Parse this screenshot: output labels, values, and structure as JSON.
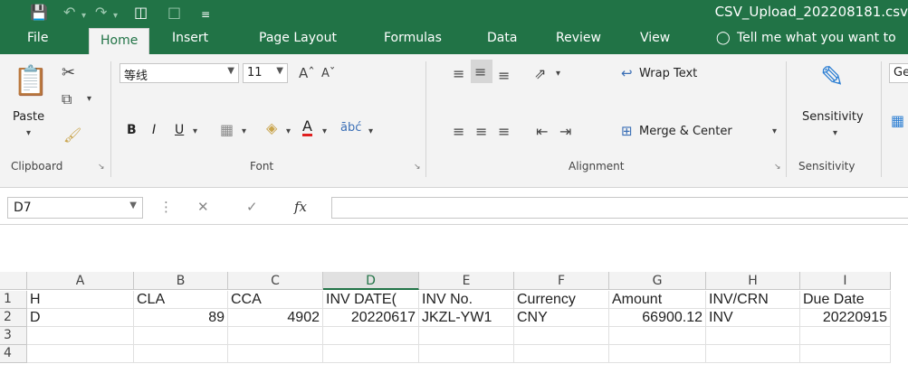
{
  "window": {
    "title": "CSV_Upload_202208181.csv"
  },
  "tabs": [
    "File",
    "Home",
    "Insert",
    "Page Layout",
    "Formulas",
    "Data",
    "Review",
    "View"
  ],
  "active_tab": "Home",
  "tell_me": "Tell me what you want to",
  "clipboard": {
    "paste": "Paste",
    "label": "Clipboard"
  },
  "font": {
    "name": "等线",
    "size": "11",
    "bold": "B",
    "italic": "I",
    "underline": "U",
    "color_letter": "A",
    "label": "Font"
  },
  "alignment": {
    "wrap_text": "Wrap Text",
    "merge_center": "Merge & Center",
    "label": "Alignment"
  },
  "sensitivity": {
    "button": "Sensitivity",
    "label": "Sensitivity"
  },
  "number_format_partial": "Ge",
  "name_box": "D7",
  "fx": "fx",
  "columns": [
    "A",
    "B",
    "C",
    "D",
    "E",
    "F",
    "G",
    "H",
    "I"
  ],
  "rows": [
    "1",
    "2",
    "3",
    "4"
  ],
  "cells": {
    "r1": [
      "H",
      "CLA",
      "CCA",
      "INV DATE(",
      "INV No.",
      "Currency",
      "Amount",
      "INV/CRN",
      "Due Date"
    ],
    "r2": [
      "D",
      "89",
      "4902",
      "20220617",
      "JKZL-YW1",
      "CNY",
      "66900.12",
      "INV",
      "20220915"
    ]
  },
  "colors": {
    "brand": "#217346",
    "ribbon_bg": "#f3f3f3"
  }
}
